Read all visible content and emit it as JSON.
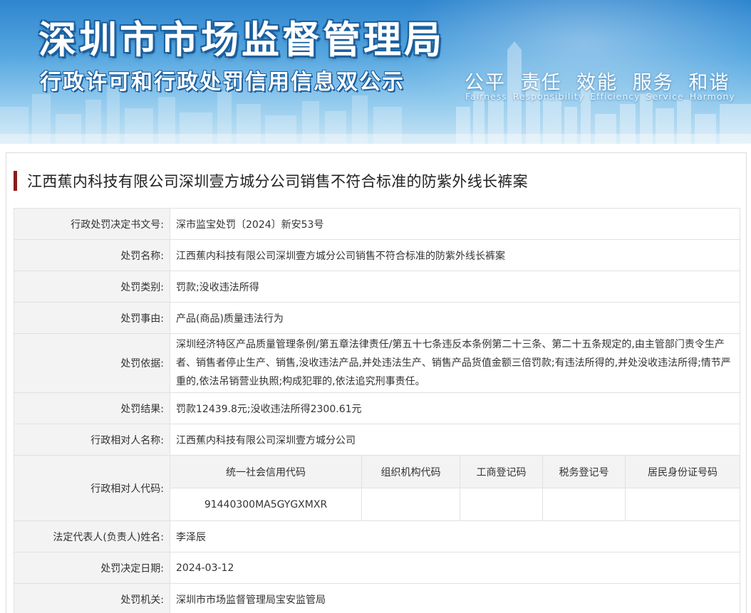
{
  "banner": {
    "title_main": "深圳市市场监督管理局",
    "title_sub": "行政许可和行政处罚信用信息双公示",
    "slogan_cn": "公平 责任 效能 服务 和谐",
    "slogan_en": "Fairness Responsibility Efficiency Service Harmony"
  },
  "case": {
    "title": "江西蕉内科技有限公司深圳壹方城分公司销售不符合标准的防紫外线长裤案"
  },
  "rows": {
    "decision_no": {
      "label": "行政处罚决定书文号:",
      "value": "深市监宝处罚〔2024〕新安53号"
    },
    "name": {
      "label": "处罚名称:",
      "value": "江西蕉内科技有限公司深圳壹方城分公司销售不符合标准的防紫外线长裤案"
    },
    "category": {
      "label": "处罚类别:",
      "value": "罚款;没收违法所得"
    },
    "cause": {
      "label": "处罚事由:",
      "value": "产品(商品)质量违法行为"
    },
    "basis": {
      "label": "处罚依据:",
      "value": "深圳经济特区产品质量管理条例/第五章法律责任/第五十七条违反本条例第二十三条、第二十五条规定的,由主管部门责令生产者、销售者停止生产、销售,没收违法产品,并处违法生产、销售产品货值金额三倍罚款;有违法所得的,并处没收违法所得;情节严重的,依法吊销营业执照;构成犯罪的,依法追究刑事责任。"
    },
    "result": {
      "label": "处罚结果:",
      "value": "罚款12439.8元;没收违法所得2300.61元"
    },
    "party_name": {
      "label": "行政相对人名称:",
      "value": "江西蕉内科技有限公司深圳壹方城分公司"
    },
    "party_code": {
      "label": "行政相对人代码:",
      "headers": [
        "统一社会信用代码",
        "组织机构代码",
        "工商登记码",
        "税务登记号",
        "居民身份证号码"
      ],
      "values": [
        "91440300MA5GYGXMXR",
        "",
        "",
        "",
        ""
      ]
    },
    "legal_rep": {
      "label": "法定代表人(负责人)姓名:",
      "value": "李泽辰"
    },
    "date": {
      "label": "处罚决定日期:",
      "value": "2024-03-12"
    },
    "authority": {
      "label": "处罚机关:",
      "value": "深圳市市场监督管理局宝安监管局"
    }
  }
}
